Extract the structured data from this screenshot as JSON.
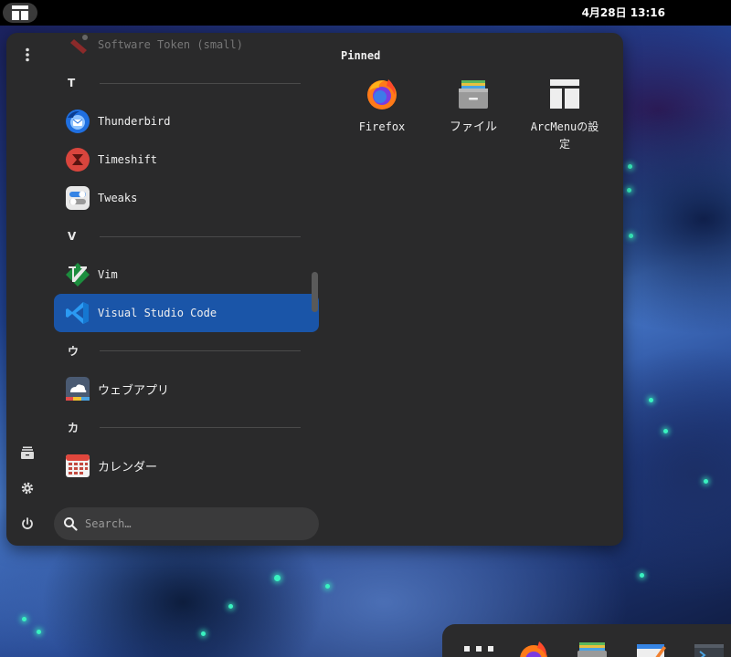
{
  "topbar": {
    "clock": "4月28日  13:16",
    "menu_icon": "arcmenu-layout-icon"
  },
  "side_rail": {
    "items": [
      {
        "icon": "more-vertical-icon"
      },
      {
        "icon": "file-manager-icon"
      },
      {
        "icon": "settings-gear-icon"
      },
      {
        "icon": "power-icon"
      }
    ]
  },
  "apps": {
    "partial_top": "Software Token (small)",
    "sections": [
      {
        "letter": "T",
        "items": [
          "Thunderbird",
          "Timeshift",
          "Tweaks"
        ]
      },
      {
        "letter": "V",
        "items": [
          "Vim",
          "Visual Studio Code"
        ]
      },
      {
        "letter": "ウ",
        "items": [
          "ウェブアプリ"
        ]
      },
      {
        "letter": "カ",
        "items": [
          "カレンダー"
        ]
      }
    ],
    "selected": "Visual Studio Code"
  },
  "search": {
    "placeholder": "Search…"
  },
  "pinned": {
    "title": "Pinned",
    "items": [
      {
        "label": "Firefox",
        "icon": "firefox-icon"
      },
      {
        "label": "ファイル",
        "icon": "files-icon"
      },
      {
        "label": "ArcMenuの設\n定",
        "icon": "arcmenu-settings-icon"
      }
    ]
  },
  "dock": {
    "items": [
      "app-grid-icon",
      "firefox-icon",
      "files-icon",
      "text-editor-icon",
      "terminal-icon"
    ]
  },
  "colors": {
    "panel_bg": "#2a2a2b",
    "selection": "#1a55a8",
    "topbar": "#000000"
  }
}
